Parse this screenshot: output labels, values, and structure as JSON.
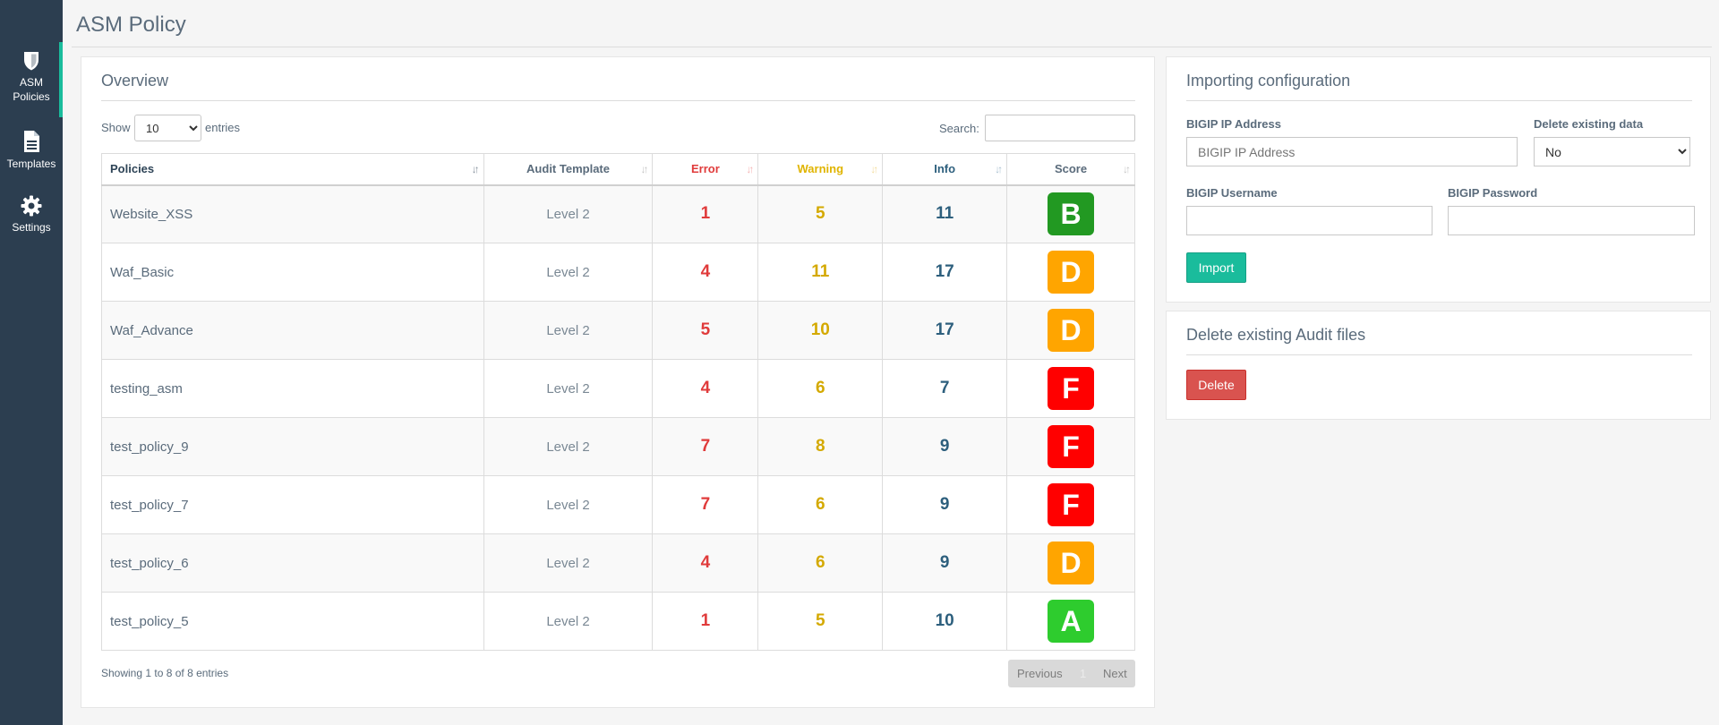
{
  "sidebar": {
    "items": [
      {
        "label_line1": "ASM",
        "label_line2": "Policies",
        "icon": "shield-icon",
        "active": true
      },
      {
        "label": "Templates",
        "icon": "document-icon"
      },
      {
        "label": "Settings",
        "icon": "gear-icon"
      }
    ]
  },
  "page": {
    "title": "ASM Policy"
  },
  "overview": {
    "title": "Overview",
    "show_label": "Show",
    "entries_value": "10",
    "entries_label": "entries",
    "search_label": "Search:",
    "columns": [
      "Policies",
      "Audit Template",
      "Error",
      "Warning",
      "Info",
      "Score"
    ],
    "rows": [
      {
        "policy": "Website_XSS",
        "template": "Level 2",
        "error": "1",
        "warning": "5",
        "info": "11",
        "score": "B"
      },
      {
        "policy": "Waf_Basic",
        "template": "Level 2",
        "error": "4",
        "warning": "11",
        "info": "17",
        "score": "D"
      },
      {
        "policy": "Waf_Advance",
        "template": "Level 2",
        "error": "5",
        "warning": "10",
        "info": "17",
        "score": "D"
      },
      {
        "policy": "testing_asm",
        "template": "Level 2",
        "error": "4",
        "warning": "6",
        "info": "7",
        "score": "F"
      },
      {
        "policy": "test_policy_9",
        "template": "Level 2",
        "error": "7",
        "warning": "8",
        "info": "9",
        "score": "F"
      },
      {
        "policy": "test_policy_7",
        "template": "Level 2",
        "error": "7",
        "warning": "6",
        "info": "9",
        "score": "F"
      },
      {
        "policy": "test_policy_6",
        "template": "Level 2",
        "error": "4",
        "warning": "6",
        "info": "9",
        "score": "D"
      },
      {
        "policy": "test_policy_5",
        "template": "Level 2",
        "error": "1",
        "warning": "5",
        "info": "10",
        "score": "A"
      }
    ],
    "footer_info": "Showing 1 to 8 of 8 entries",
    "pager": {
      "previous": "Previous",
      "page": "1",
      "next": "Next"
    }
  },
  "importing": {
    "title": "Importing configuration",
    "ip_label": "BIGIP IP Address",
    "ip_placeholder": "BIGIP IP Address",
    "delete_label": "Delete existing data",
    "delete_value": "No",
    "username_label": "BIGIP Username",
    "password_label": "BIGIP Password",
    "import_button": "Import"
  },
  "delete_audit": {
    "title": "Delete existing Audit files",
    "delete_button": "Delete"
  },
  "colors": {
    "sidebar_bg": "#2c3e50",
    "accent": "#1abc9c",
    "error": "#e03b3b",
    "warning": "#d4a900",
    "info": "#2d5f7d",
    "danger_button": "#d9534f",
    "grade_A": "#2ecc2e",
    "grade_B": "#229922",
    "grade_D": "#ffa500",
    "grade_F": "#ff0000"
  }
}
